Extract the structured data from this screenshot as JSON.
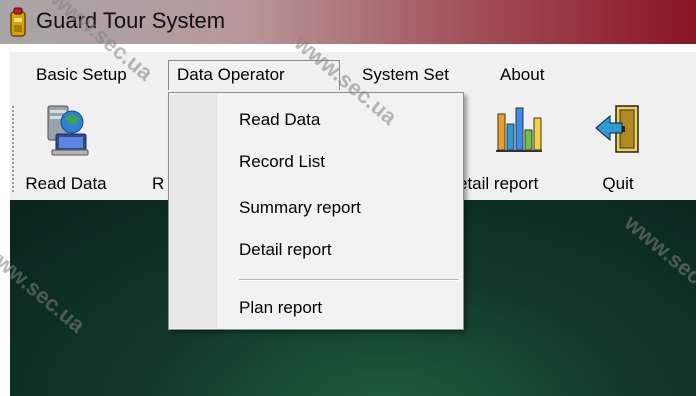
{
  "window": {
    "title": "Guard Tour System"
  },
  "menubar": {
    "items": [
      {
        "label": "Basic Setup"
      },
      {
        "label": "Data Operator"
      },
      {
        "label": "System Set"
      },
      {
        "label": "About"
      }
    ]
  },
  "toolbar": {
    "read_data": "Read Data",
    "record_list_partial": "R",
    "detail_report_partial": "etail  report",
    "quit": "Quit"
  },
  "dropdown": {
    "items": [
      {
        "label": "Read Data"
      },
      {
        "label": "Record List"
      },
      {
        "label": "Summary report"
      },
      {
        "label": "Detail report"
      },
      {
        "label": "Plan report"
      }
    ]
  },
  "watermark": "www.sec.ua",
  "colors": {
    "titlebar_end": "#8a1522",
    "desktop": "#0c2b22",
    "menu_bg": "#f0f0f0"
  }
}
